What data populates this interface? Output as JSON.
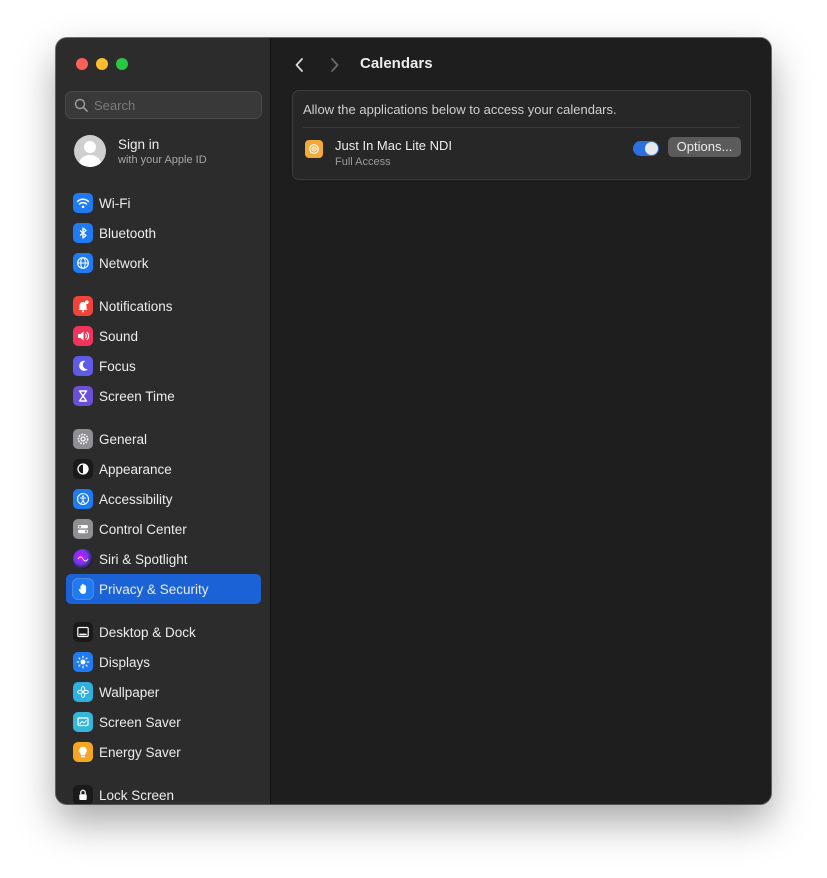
{
  "window": {
    "traffic_lights": [
      "close",
      "minimize",
      "maximize"
    ]
  },
  "sidebar": {
    "search": {
      "placeholder": "Search",
      "value": ""
    },
    "account": {
      "title": "Sign in",
      "subtitle": "with your Apple ID"
    },
    "items": [
      {
        "label": "Wi-Fi",
        "icon": "wifi-icon",
        "color": "#1e7bf2"
      },
      {
        "label": "Bluetooth",
        "icon": "bluetooth-icon",
        "color": "#1e7bf2"
      },
      {
        "label": "Network",
        "icon": "globe-icon",
        "color": "#1e7bf2"
      },
      {
        "label": "Notifications",
        "icon": "bell-icon",
        "color": "#f0443a"
      },
      {
        "label": "Sound",
        "icon": "speaker-icon",
        "color": "#f0345a"
      },
      {
        "label": "Focus",
        "icon": "moon-icon",
        "color": "#5e5ce6"
      },
      {
        "label": "Screen Time",
        "icon": "hourglass-icon",
        "color": "#6a4fd8"
      },
      {
        "label": "General",
        "icon": "gear-icon",
        "color": "#8e8e93"
      },
      {
        "label": "Appearance",
        "icon": "appearance-icon",
        "color": "#1a1a1a"
      },
      {
        "label": "Accessibility",
        "icon": "accessibility-icon",
        "color": "#1e7bf2"
      },
      {
        "label": "Control Center",
        "icon": "switches-icon",
        "color": "#8e8e93"
      },
      {
        "label": "Siri & Spotlight",
        "icon": "siri-icon",
        "color": "#b03fd1"
      },
      {
        "label": "Privacy & Security",
        "icon": "hand-icon",
        "color": "#1e7bf2",
        "active": true
      },
      {
        "label": "Desktop & Dock",
        "icon": "dock-icon",
        "color": "#1a1a1a"
      },
      {
        "label": "Displays",
        "icon": "sun-icon",
        "color": "#1e7bf2"
      },
      {
        "label": "Wallpaper",
        "icon": "flower-icon",
        "color": "#30b0e0"
      },
      {
        "label": "Screen Saver",
        "icon": "screensaver-icon",
        "color": "#35b5d8"
      },
      {
        "label": "Energy Saver",
        "icon": "bulb-icon",
        "color": "#f5a623"
      },
      {
        "label": "Lock Screen",
        "icon": "lock-icon",
        "color": "#1a1a1a"
      }
    ]
  },
  "toolbar": {
    "title": "Calendars",
    "back_icon": "chevron-left-icon",
    "forward_icon": "chevron-right-icon"
  },
  "panel": {
    "description": "Allow the applications below to access your calendars.",
    "apps": [
      {
        "name": "Just In Mac Lite NDI",
        "access": "Full Access",
        "icon": "app-icon",
        "icon_color": "#f2a93b",
        "enabled": true,
        "options_label": "Options..."
      }
    ]
  }
}
